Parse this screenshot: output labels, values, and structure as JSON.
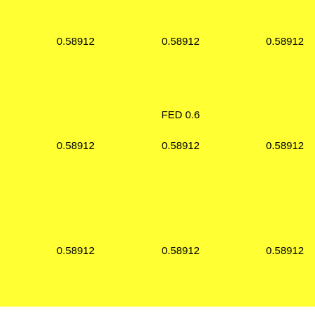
{
  "background_color": "#ffff33",
  "title": "FED 0.6",
  "grid": [
    [
      "0.58912",
      "0.58912",
      "0.58912"
    ],
    [
      "0.58912",
      "0.58912",
      "0.58912"
    ],
    [
      "0.58912",
      "0.58912",
      "0.58912"
    ]
  ]
}
